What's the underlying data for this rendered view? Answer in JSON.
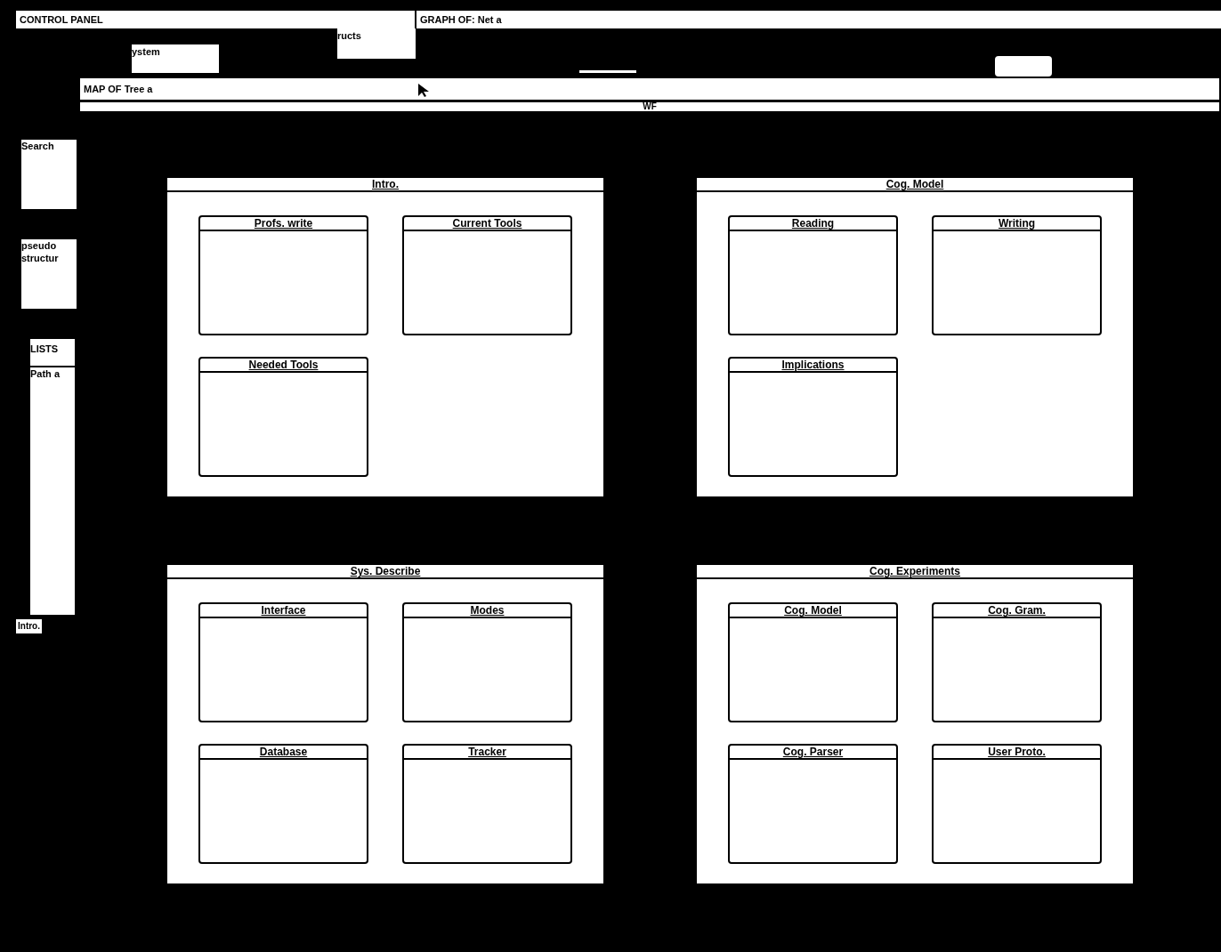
{
  "control_panel": {
    "title": "CONTROL PANEL",
    "buttons": [
      {
        "label": "ystem"
      },
      {
        "label": "ructs"
      }
    ]
  },
  "graph_window": {
    "title": "GRAPH OF: Net a"
  },
  "map_window": {
    "title": "MAP OF Tree a",
    "subtitle": "WF"
  },
  "sidebar": {
    "items": [
      {
        "kind": "box",
        "lines": [
          "Search"
        ]
      },
      {
        "kind": "box",
        "lines": [
          "pseudo",
          "structur"
        ]
      },
      {
        "kind": "list",
        "header": "LISTS",
        "lines": [
          "Path a"
        ]
      }
    ],
    "tag": "Intro."
  },
  "panels": [
    {
      "title": "Intro.",
      "cards": [
        "Profs. write",
        "Current Tools",
        "Needed Tools"
      ]
    },
    {
      "title": "Cog. Model",
      "cards": [
        "Reading",
        "Writing",
        "Implications"
      ]
    },
    {
      "title": "Sys. Describe",
      "cards": [
        "Interface",
        "Modes",
        "Database",
        "Tracker"
      ]
    },
    {
      "title": "Cog. Experiments",
      "cards": [
        "Cog. Model",
        "Cog. Gram.",
        "Cog. Parser",
        "User Proto."
      ]
    }
  ]
}
